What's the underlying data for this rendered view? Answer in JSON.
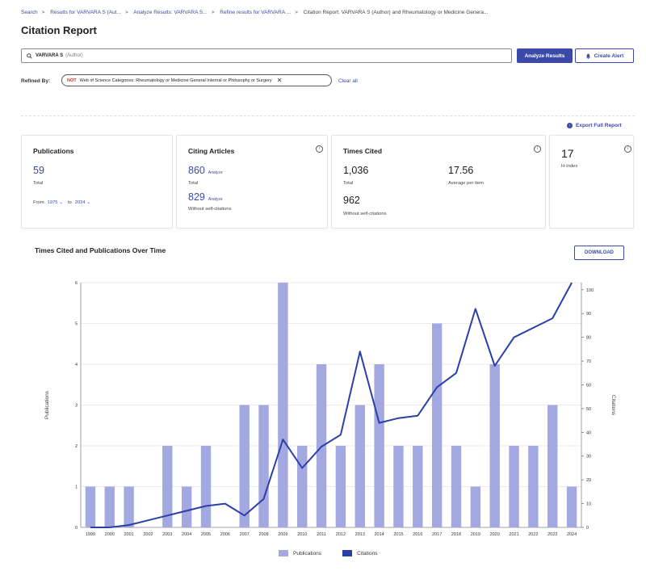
{
  "breadcrumb": [
    "Search",
    "Results for VARVARA S (Aut...",
    "Analyze Results: VARVARA S...",
    "Refine results for VARVARA ...",
    "Citation Report: VARVARA S (Author) and Rheumatology or Medicine Genera..."
  ],
  "page": {
    "title": "Citation Report"
  },
  "search": {
    "query": "VARVARA S",
    "field_tag": "(Author)"
  },
  "buttons": {
    "analyze": "Analyze Results",
    "create_alert": "Create Alert",
    "download": "DOWNLOAD"
  },
  "refine": {
    "label": "Refined By:",
    "not_tag": "NOT",
    "filter_text": "Web of Science Categories: Rheumatology or Medicine General Internal or Philosophy or Surgery",
    "clear": "Clear all"
  },
  "export": {
    "label": "Export Full Report"
  },
  "cards": {
    "publications": {
      "title": "Publications",
      "value": "59",
      "value_label": "Total",
      "from_label": "From",
      "from_value": "1975",
      "to_label": "to",
      "to_value": "2024"
    },
    "citing": {
      "title": "Citing Articles",
      "total_value": "860",
      "total_label": "Total",
      "without_value": "829",
      "without_label": "Without self-citations",
      "analyze_label": "Analyze"
    },
    "times_cited": {
      "title": "Times Cited",
      "total_value": "1,036",
      "total_label": "Total",
      "avg_value": "17.56",
      "avg_label": "Average per item",
      "without_value": "962",
      "without_label": "Without self-citations"
    },
    "hindex": {
      "value": "17",
      "label": "H-Index"
    }
  },
  "chart_data": {
    "type": "bar",
    "title": "Times Cited and Publications Over Time",
    "categories": [
      "1999",
      "2000",
      "2001",
      "2002",
      "2003",
      "2004",
      "2005",
      "2006",
      "2007",
      "2008",
      "2009",
      "2010",
      "2011",
      "2012",
      "2013",
      "2014",
      "2015",
      "2016",
      "2017",
      "2018",
      "2019",
      "2020",
      "2021",
      "2022",
      "2023",
      "2024"
    ],
    "series": [
      {
        "name": "Publications",
        "type": "bar",
        "axis": "left",
        "values": [
          1,
          1,
          1,
          0,
          2,
          1,
          2,
          0,
          3,
          3,
          6,
          2,
          4,
          2,
          3,
          4,
          2,
          2,
          5,
          2,
          1,
          4,
          2,
          2,
          3,
          1
        ]
      },
      {
        "name": "Citations",
        "type": "line",
        "axis": "right",
        "values": [
          0,
          0,
          1,
          3,
          5,
          7,
          9,
          10,
          5,
          12,
          37,
          25,
          34,
          39,
          74,
          44,
          46,
          47,
          59,
          65,
          92,
          68,
          80,
          84,
          88,
          103
        ]
      }
    ],
    "ylabel": "Publications",
    "y2label": "Citations",
    "ylim": [
      0,
      6
    ],
    "y2lim": [
      0,
      103
    ],
    "y_ticks": [
      0,
      1,
      2,
      3,
      4,
      5,
      6
    ],
    "y2_ticks": [
      0,
      10,
      20,
      30,
      40,
      50,
      60,
      70,
      80,
      90,
      100
    ],
    "legend_position": "bottom-center",
    "colors": {
      "bar": "#a3a8e0",
      "line": "#2a3fa8"
    }
  }
}
